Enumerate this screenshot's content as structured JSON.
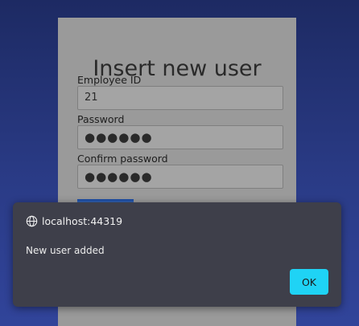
{
  "form": {
    "title": "Insert new user",
    "employee_id_label": "Employee ID",
    "employee_id_value": "21",
    "password_label": "Password",
    "password_value": "●●●●●●",
    "confirm_label": "Confirm password",
    "confirm_value": "●●●●●●"
  },
  "dialog": {
    "origin": "localhost:44319",
    "message": "New user added",
    "ok_label": "OK",
    "icon": "globe-icon"
  },
  "colors": {
    "accent": "#1fd3f5",
    "dialog_bg": "#3e3f4a"
  }
}
